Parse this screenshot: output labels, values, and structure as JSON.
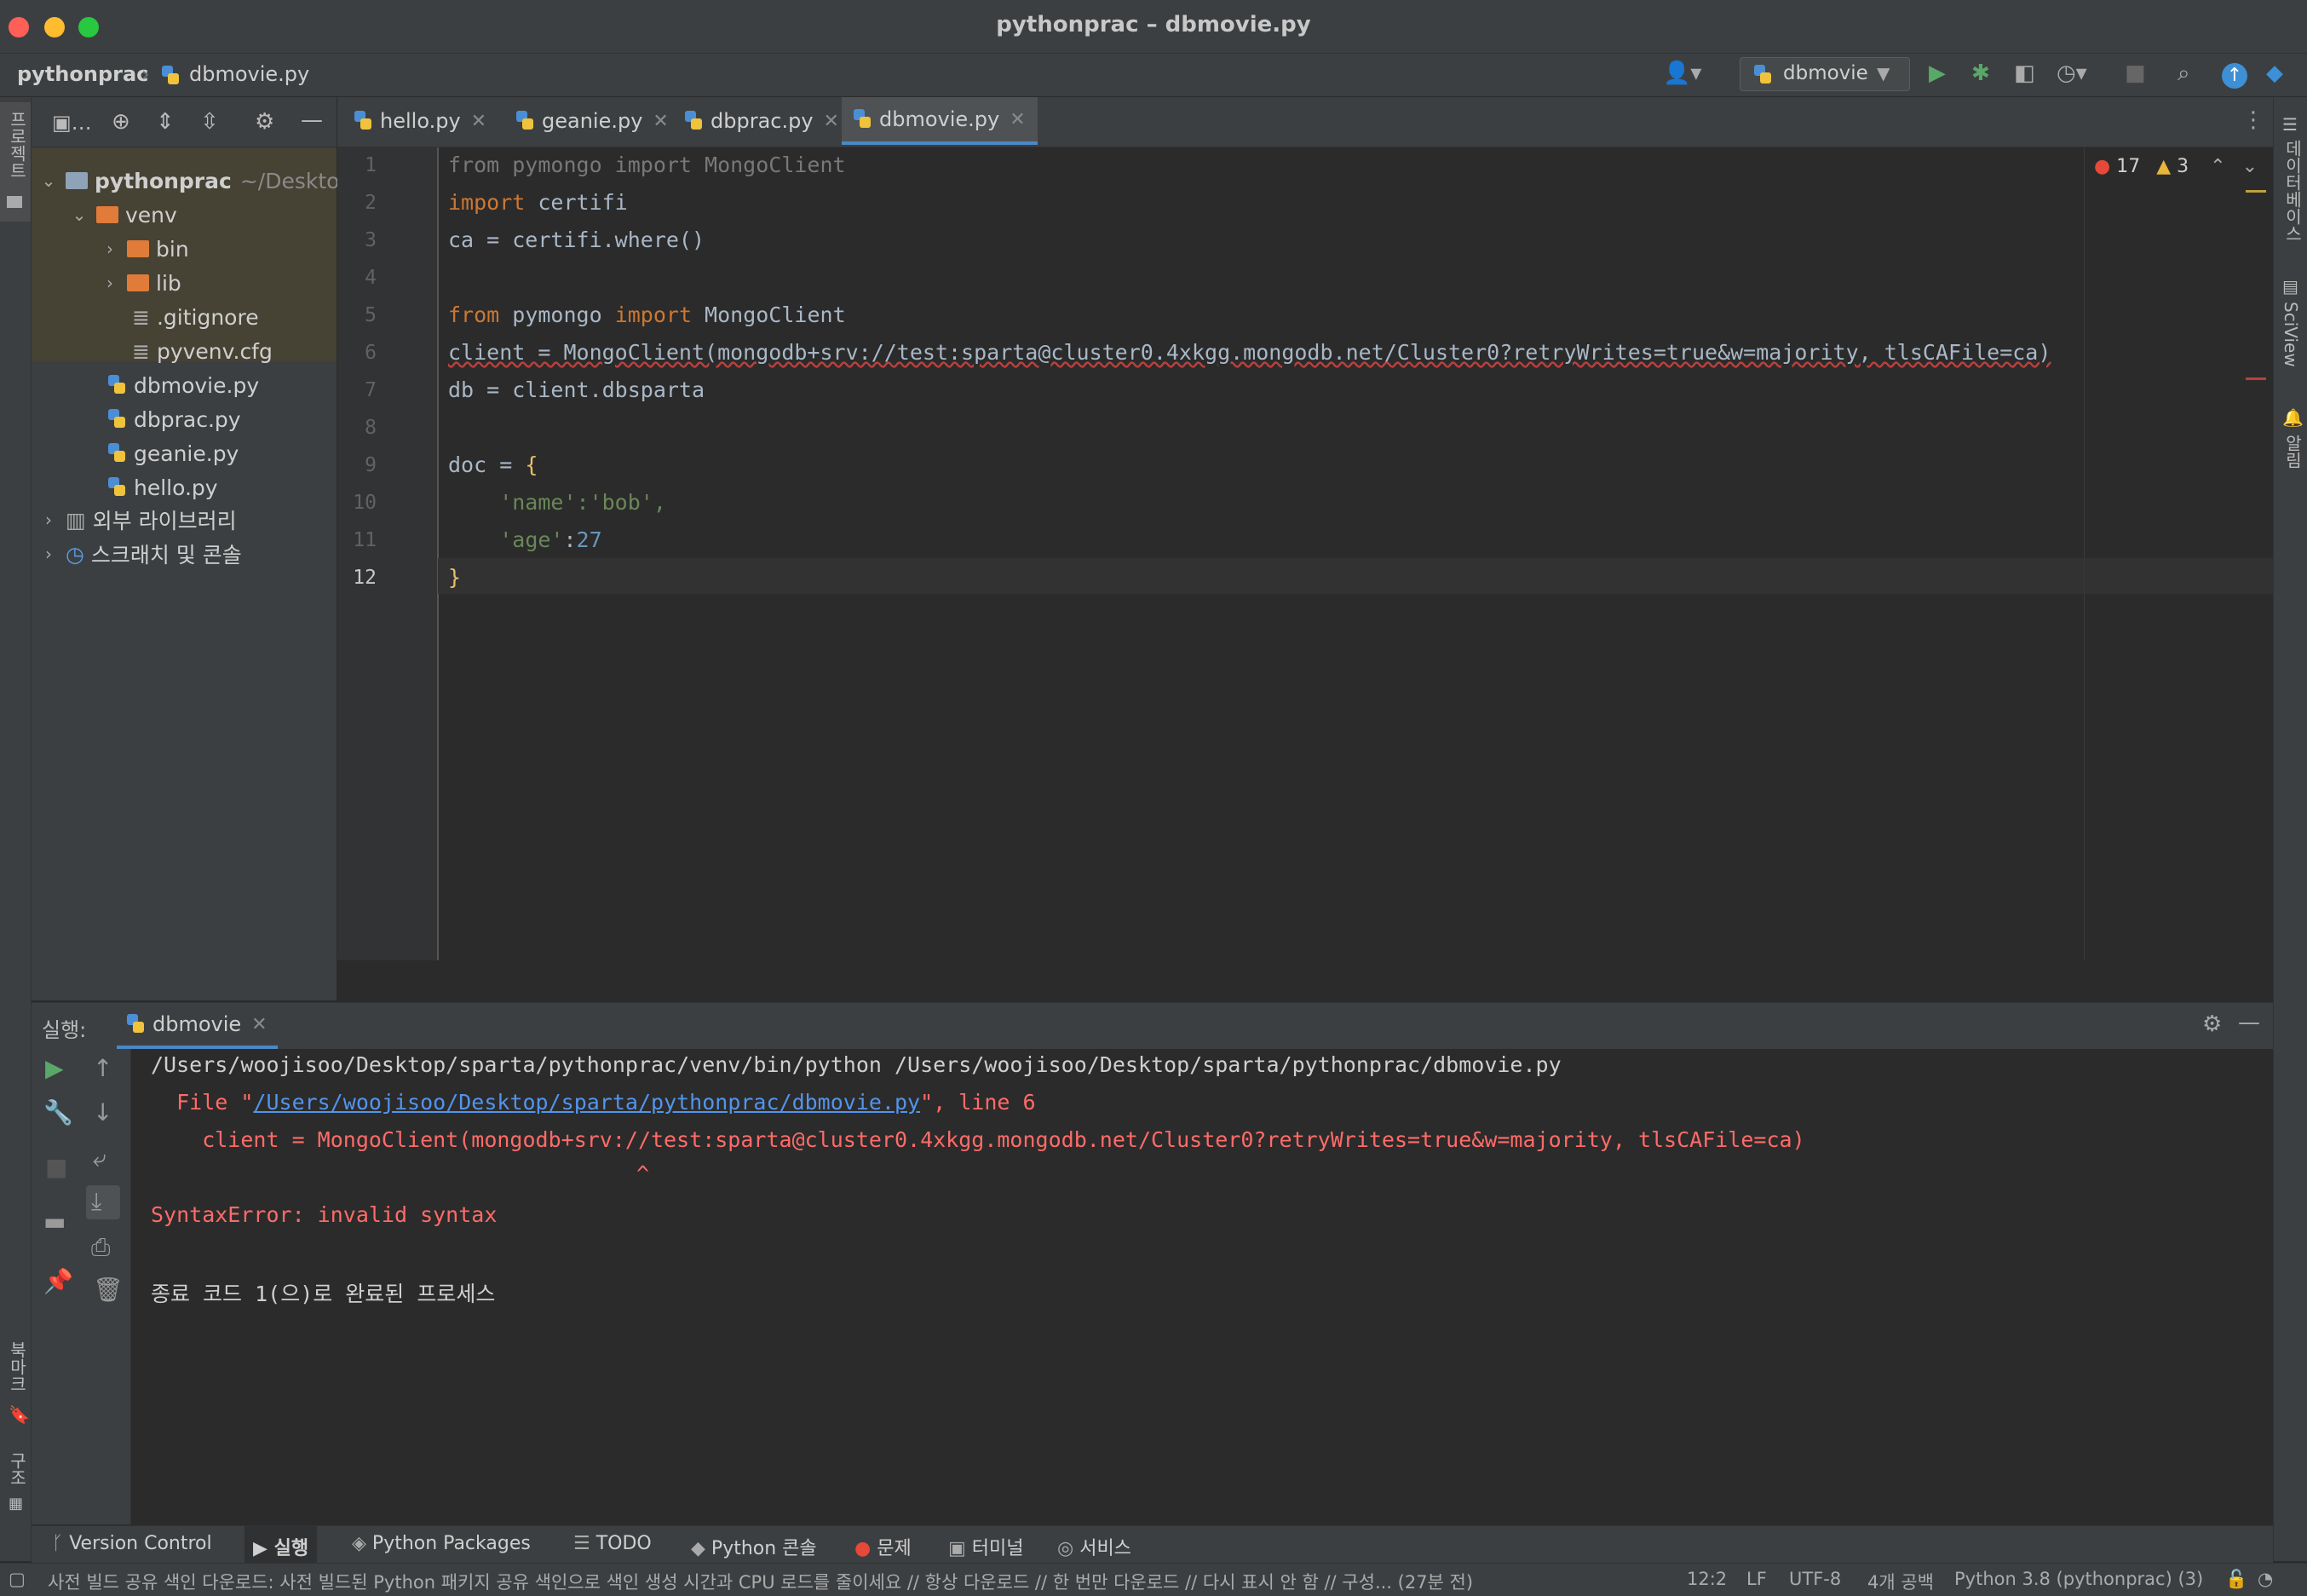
{
  "window": {
    "title": "pythonprac – dbmovie.py"
  },
  "breadcrumb": {
    "project": "pythonprac",
    "file": "dbmovie.py"
  },
  "run_config": {
    "name": "dbmovie"
  },
  "left_stripe": {
    "project": "프로젝트",
    "bookmarks": "북마크",
    "structure": "구조"
  },
  "right_stripe": {
    "database": "데이터베이스",
    "sciview": "SciView",
    "notifications": "알림"
  },
  "project_tree": {
    "root": "pythonprac",
    "root_path": "~/Deskto",
    "venv": "venv",
    "bin": "bin",
    "lib": "lib",
    "gitignore": ".gitignore",
    "pyvenv": "pyvenv.cfg",
    "files": [
      "dbmovie.py",
      "dbprac.py",
      "geanie.py",
      "hello.py"
    ],
    "external_libs": "외부 라이브러리",
    "scratches": "스크래치 및 콘솔"
  },
  "tabs": [
    "hello.py",
    "geanie.py",
    "dbprac.py",
    "dbmovie.py"
  ],
  "inspections": {
    "errors": "17",
    "warnings": "3"
  },
  "code_lines": [
    "from pymongo import MongoClient",
    "import certifi",
    "ca = certifi.where()",
    "",
    "from pymongo import MongoClient",
    "client = MongoClient(mongodb+srv://test:sparta@cluster0.4xkgg.mongodb.net/Cluster0?retryWrites=true&w=majority, tlsCAFile=ca)",
    "db = client.dbsparta",
    "",
    "doc = {",
    "    'name':'bob',",
    "    'age':27",
    "}"
  ],
  "line_numbers": [
    "1",
    "2",
    "3",
    "4",
    "5",
    "6",
    "7",
    "8",
    "9",
    "10",
    "11",
    "12"
  ],
  "run": {
    "label": "실행:",
    "tab": "dbmovie",
    "output": {
      "cmd": "/Users/woojisoo/Desktop/sparta/pythonprac/venv/bin/python /Users/woojisoo/Desktop/sparta/pythonprac/dbmovie.py",
      "file_prefix": "  File \"",
      "file_link": "/Users/woojisoo/Desktop/sparta/pythonprac/dbmovie.py",
      "file_suffix": "\", line 6",
      "src": "    client = MongoClient(mongodb+srv://test:sparta@cluster0.4xkgg.mongodb.net/Cluster0?retryWrites=true&w=majority, tlsCAFile=ca)",
      "caret": "^",
      "error": "SyntaxError: invalid syntax",
      "exit": "종료 코드 1(으)로 완료된 프로세스"
    }
  },
  "tool_tabs": [
    "Version Control",
    "실행",
    "Python Packages",
    "TODO",
    "Python 콘솔",
    "문제",
    "터미널",
    "서비스"
  ],
  "status": {
    "message": "사전 빌드 공유 색인 다운로드: 사전 빌드된 Python 패키지 공유 색인으로 색인 생성 시간과 CPU 로드를 줄이세요 // 항상 다운로드 // 한 번만 다운로드 // 다시 표시 안 함 // 구성... (27분 전)",
    "position": "12:2",
    "line_sep": "LF",
    "encoding": "UTF-8",
    "indent": "4개 공백",
    "interpreter": "Python 3.8 (pythonprac) (3)"
  },
  "colors": {
    "accent": "#4a88c7",
    "error": "#ff6b68",
    "keyword": "#cc7832",
    "string": "#6a8759"
  }
}
